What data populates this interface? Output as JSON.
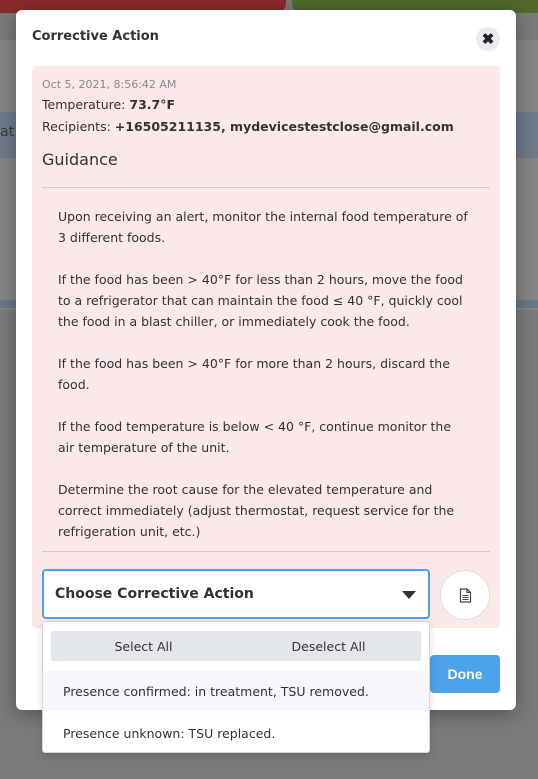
{
  "modal": {
    "title": "Corrective Action",
    "close_glyph": "✖"
  },
  "background": {
    "partial_text": "at"
  },
  "alert": {
    "timestamp": "Oct 5, 2021, 8:56:42 AM",
    "temperature_label": "Temperature:",
    "temperature_value": "73.7°F",
    "recipients_label": "Recipients:",
    "recipients_value": "+16505211135, mydevicestestclose@gmail.com"
  },
  "guidance": {
    "title": "Guidance",
    "paragraphs": [
      "Upon receiving an alert, monitor the internal food temperature of 3 different foods.",
      "If the food has been > 40°F for less than 2 hours, move the food to a refrigerator that can maintain the food ≤ 40 °F, quickly cool the food in a blast chiller, or immediately cook the food.",
      "If the food has been > 40°F for more than 2 hours, discard the food.",
      "If the food temperature is below < 40 °F, continue monitor the air temperature of the unit.",
      "Determine the root cause for the elevated temperature and correct immediately (adjust thermostat, request service for the refrigeration unit, etc.)"
    ]
  },
  "action_select": {
    "placeholder": "Choose Corrective Action",
    "select_all": "Select All",
    "deselect_all": "Deselect All",
    "options": [
      "Presence confirmed: in treatment, TSU removed.",
      "Presence unknown: TSU replaced."
    ]
  },
  "buttons": {
    "done": "Done",
    "notes_icon": "document-icon"
  },
  "colors": {
    "accent": "#4da3e8",
    "content_bg": "#fbe8e8"
  }
}
